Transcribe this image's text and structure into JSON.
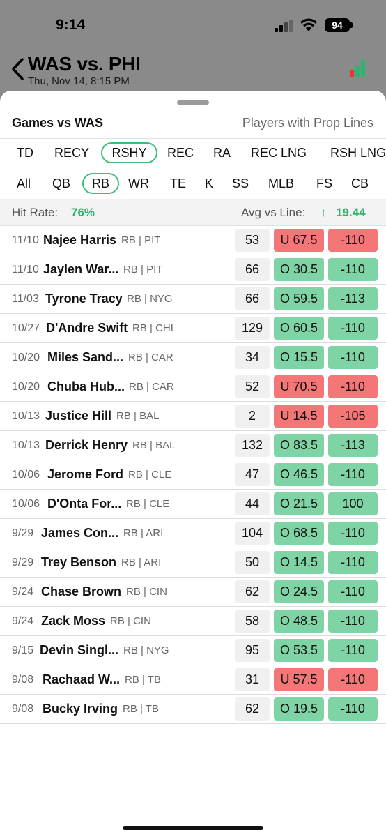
{
  "status_bar": {
    "time": "9:14",
    "battery": "94"
  },
  "header": {
    "title": "WAS vs. PHI",
    "date": "Thu, Nov 14, 8:15 PM"
  },
  "sheet": {
    "games_label": "Games vs WAS",
    "players_label": "Players with Prop Lines"
  },
  "stat_tabs": [
    "TD",
    "RECY",
    "RSHY",
    "REC",
    "RA",
    "REC LNG",
    "RSH LNG"
  ],
  "stat_tab_active": "RSHY",
  "position_tabs": [
    "All",
    "QB",
    "RB",
    "WR",
    "TE",
    "K",
    "SS",
    "MLB",
    "FS",
    "CB"
  ],
  "position_tab_active": "RB",
  "hit_rate": {
    "label": "Hit Rate:",
    "value": "76%"
  },
  "avg_vs_line": {
    "label": "Avg vs Line:",
    "arrow": "↑",
    "value": "19.44"
  },
  "colors": {
    "accent": "#3cbf7a",
    "over": "#7fd4a6",
    "under": "#f47676"
  },
  "rows": [
    {
      "date": "11/10",
      "name": "Najee Harris",
      "meta": "RB | PIT",
      "value": "53",
      "line": "U 67.5",
      "odds": "-110",
      "result": "under"
    },
    {
      "date": "11/10",
      "name": "Jaylen War...",
      "meta": "RB | PIT",
      "value": "66",
      "line": "O 30.5",
      "odds": "-110",
      "result": "over"
    },
    {
      "date": "11/03",
      "name": "Tyrone Tracy",
      "meta": "RB | NYG",
      "value": "66",
      "line": "O 59.5",
      "odds": "-113",
      "result": "over"
    },
    {
      "date": "10/27",
      "name": "D'Andre Swift",
      "meta": "RB | CHI",
      "value": "129",
      "line": "O 60.5",
      "odds": "-110",
      "result": "over"
    },
    {
      "date": "10/20",
      "name": "Miles Sand...",
      "meta": "RB | CAR",
      "value": "34",
      "line": "O 15.5",
      "odds": "-110",
      "result": "over"
    },
    {
      "date": "10/20",
      "name": "Chuba Hub...",
      "meta": "RB | CAR",
      "value": "52",
      "line": "U 70.5",
      "odds": "-110",
      "result": "under"
    },
    {
      "date": "10/13",
      "name": "Justice Hill",
      "meta": "RB | BAL",
      "value": "2",
      "line": "U 14.5",
      "odds": "-105",
      "result": "under"
    },
    {
      "date": "10/13",
      "name": "Derrick Henry",
      "meta": "RB | BAL",
      "value": "132",
      "line": "O 83.5",
      "odds": "-113",
      "result": "over"
    },
    {
      "date": "10/06",
      "name": "Jerome Ford",
      "meta": "RB | CLE",
      "value": "47",
      "line": "O 46.5",
      "odds": "-110",
      "result": "over"
    },
    {
      "date": "10/06",
      "name": "D'Onta For...",
      "meta": "RB | CLE",
      "value": "44",
      "line": "O 21.5",
      "odds": "100",
      "result": "over"
    },
    {
      "date": "9/29",
      "name": "James Con...",
      "meta": "RB | ARI",
      "value": "104",
      "line": "O 68.5",
      "odds": "-110",
      "result": "over"
    },
    {
      "date": "9/29",
      "name": "Trey Benson",
      "meta": "RB | ARI",
      "value": "50",
      "line": "O 14.5",
      "odds": "-110",
      "result": "over"
    },
    {
      "date": "9/24",
      "name": "Chase Brown",
      "meta": "RB | CIN",
      "value": "62",
      "line": "O 24.5",
      "odds": "-110",
      "result": "over"
    },
    {
      "date": "9/24",
      "name": "Zack Moss",
      "meta": "RB | CIN",
      "value": "58",
      "line": "O 48.5",
      "odds": "-110",
      "result": "over"
    },
    {
      "date": "9/15",
      "name": "Devin Singl...",
      "meta": "RB | NYG",
      "value": "95",
      "line": "O 53.5",
      "odds": "-110",
      "result": "over"
    },
    {
      "date": "9/08",
      "name": "Rachaad W...",
      "meta": "RB | TB",
      "value": "31",
      "line": "U 57.5",
      "odds": "-110",
      "result": "under"
    },
    {
      "date": "9/08",
      "name": "Bucky Irving",
      "meta": "RB | TB",
      "value": "62",
      "line": "O 19.5",
      "odds": "-110",
      "result": "over"
    }
  ]
}
